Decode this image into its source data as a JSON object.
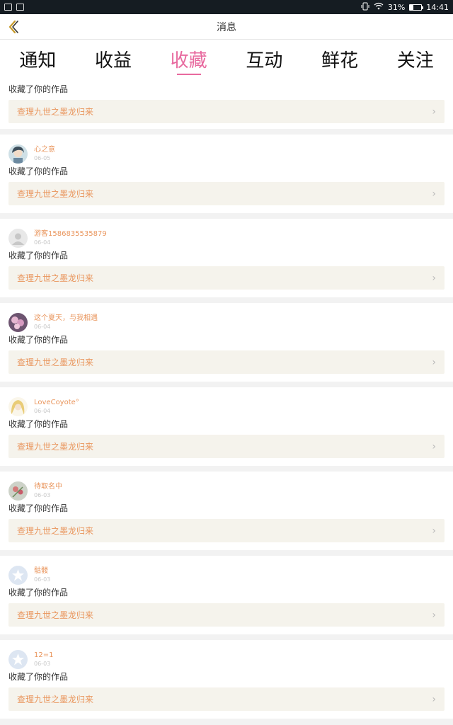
{
  "status_bar": {
    "battery": "31%",
    "battery_level": 0.31,
    "time": "14:41"
  },
  "header": {
    "title": "消息"
  },
  "tabs": [
    {
      "label": "通知"
    },
    {
      "label": "收益"
    },
    {
      "label": "收藏"
    },
    {
      "label": "互动"
    },
    {
      "label": "鲜花"
    },
    {
      "label": "关注"
    }
  ],
  "active_tab": 2,
  "colors": {
    "accent": "#e86a9f",
    "name": "#e9955c",
    "card": "#f5f3ec"
  },
  "first_item": {
    "action": "收藏了你的作品",
    "work_title": "查理九世之墨龙归来"
  },
  "items": [
    {
      "user": "心之意",
      "date": "06-05",
      "action": "收藏了你的作品",
      "work_title": "查理九世之墨龙归来",
      "avatar": "anime-avatar"
    },
    {
      "user": "游客1586835535879",
      "date": "06-04",
      "action": "收藏了你的作品",
      "work_title": "查理九世之墨龙归来",
      "avatar": "default-avatar"
    },
    {
      "user": "这个夏天，与我相遇",
      "date": "06-04",
      "action": "收藏了你的作品",
      "work_title": "查理九世之墨龙归来",
      "avatar": "flower-avatar"
    },
    {
      "user": "LoveCoyote°",
      "date": "06-04",
      "action": "收藏了你的作品",
      "work_title": "查理九世之墨龙归来",
      "avatar": "blonde-avatar"
    },
    {
      "user": "待取名中",
      "date": "06-03",
      "action": "收藏了你的作品",
      "work_title": "查理九世之墨龙归来",
      "avatar": "floral-avatar"
    },
    {
      "user": "骷髅",
      "date": "06-03",
      "action": "收藏了你的作品",
      "work_title": "查理九世之墨龙归来",
      "avatar": "star-avatar"
    },
    {
      "user": "12=1",
      "date": "06-03",
      "action": "收藏了你的作品",
      "work_title": "查理九世之墨龙归来",
      "avatar": "star-avatar"
    }
  ]
}
